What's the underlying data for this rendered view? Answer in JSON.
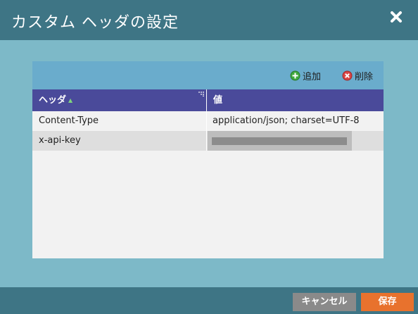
{
  "dialog": {
    "title": "カスタム ヘッダの設定"
  },
  "toolbar": {
    "add_label": "追加",
    "delete_label": "削除"
  },
  "grid": {
    "columns": [
      "ヘッダ",
      "値"
    ],
    "rows": [
      {
        "header": "Content-Type",
        "value": "application/json; charset=UTF-8",
        "masked": false
      },
      {
        "header": "x-api-key",
        "value": "",
        "masked": true
      }
    ]
  },
  "footer": {
    "cancel_label": "キャンセル",
    "save_label": "保存"
  },
  "colors": {
    "titlebar": "#3e7585",
    "content_bg": "#7db9c8",
    "toolbar": "#6aaccc",
    "grid_header": "#4a4a9a",
    "save_button": "#e8722d",
    "cancel_button": "#8a8a8a"
  },
  "icons": {
    "close": "close-icon",
    "add": "add-icon",
    "delete": "delete-icon",
    "sort": "sort-indicator-icon"
  }
}
